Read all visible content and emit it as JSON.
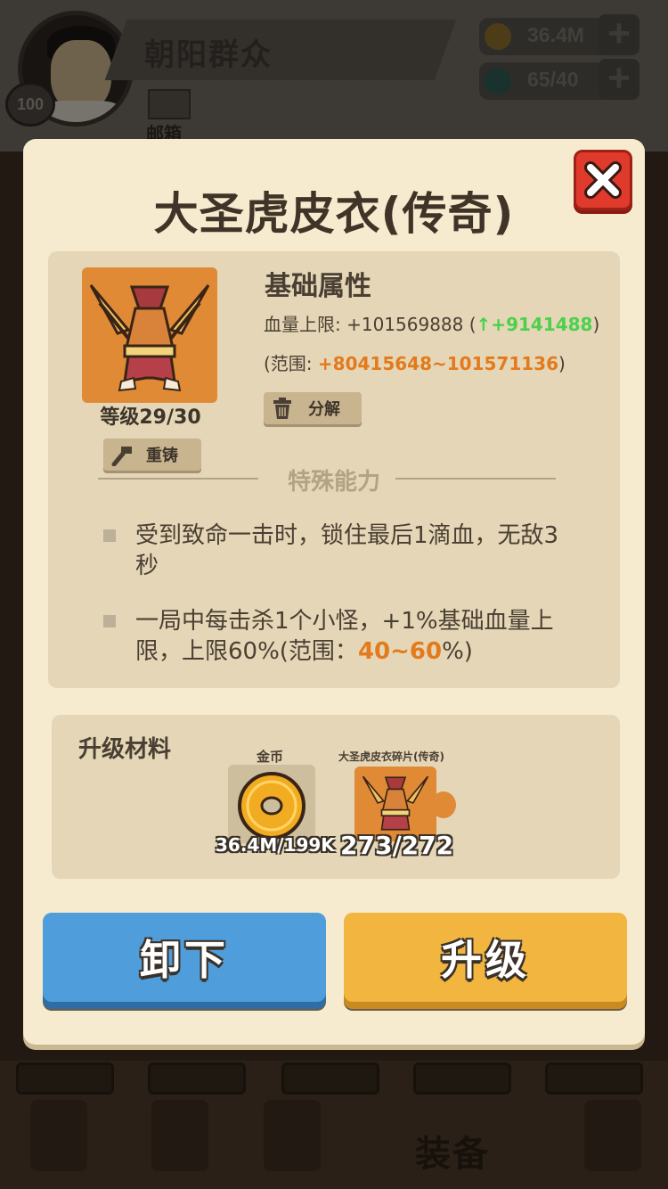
{
  "header": {
    "player_name": "朝阳群众",
    "level": "100",
    "mail_label": "邮箱",
    "gold": "36.4M",
    "gems": "65/40"
  },
  "bottom_nav": {
    "equip_label": "装备"
  },
  "modal": {
    "title": "大圣虎皮衣(传奇)",
    "item_level": "等级29/30",
    "recast_label": "重铸",
    "decompose_label": "分解",
    "base_attr_title": "基础属性",
    "hp_label": "血量上限: +101569888 (",
    "hp_bonus": "↑+9141488",
    "hp_close": ")",
    "range_label": "(范围: ",
    "range_value": "+80415648~101571136",
    "range_close": ")",
    "special_title": "特殊能力",
    "ability1": "受到致命一击时，锁住最后1滴血，无敌3秒",
    "ability2_prefix": "一局中每击杀1个小怪，+1%基础血量上限，上限60%(范围：",
    "ability2_range": "40~60",
    "ability2_suffix": "%)",
    "materials_title": "升级材料",
    "coin_label": "金币",
    "coin_count": "36.4M/199K",
    "shard_label": "大圣虎皮衣碎片(传奇)",
    "shard_count": "273/272",
    "unequip_label": "卸下",
    "upgrade_label": "升级"
  },
  "colors": {
    "bonus_green": "#4bd14b",
    "range_orange": "#e37a1c",
    "unequip_blue": "#4f9ddb",
    "upgrade_yellow": "#f2b540",
    "close_red": "#e03a2c"
  }
}
